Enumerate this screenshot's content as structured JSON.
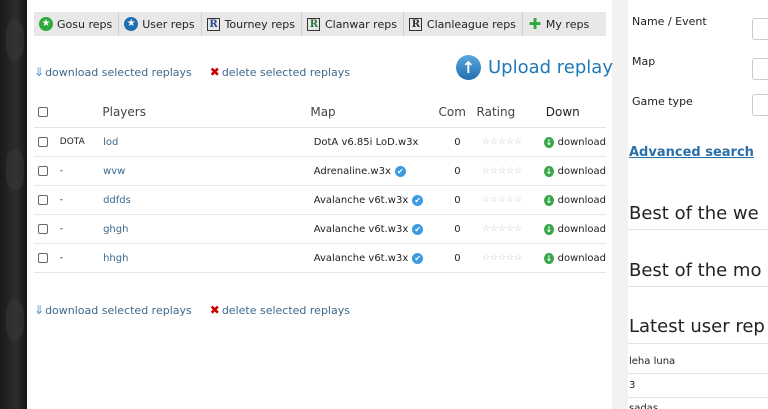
{
  "tabs": [
    {
      "label": "Gosu reps",
      "icon": "green-star-circle-icon"
    },
    {
      "label": "User reps",
      "icon": "blue-star-circle-icon"
    },
    {
      "label": "Tourney reps",
      "icon": "r-box-icon"
    },
    {
      "label": "Clanwar reps",
      "icon": "r-box-green-icon"
    },
    {
      "label": "Clanleague reps",
      "icon": "r-box-icon"
    },
    {
      "label": "My reps",
      "icon": "green-plus-icon"
    }
  ],
  "actions": {
    "download_selected": "download selected replays",
    "delete_selected": "delete selected replays"
  },
  "upload_label": "Upload replay",
  "table": {
    "headers": {
      "players": "Players",
      "map": "Map",
      "com": "Com",
      "rating": "Rating",
      "down": "Down"
    },
    "rows": [
      {
        "game": "DOTA",
        "player": "lod",
        "map": "DotA v6.85i LoD.w3x",
        "verified": false,
        "com": "0",
        "download": "download"
      },
      {
        "game": "-",
        "player": "wvw",
        "map": "Adrenaline.w3x",
        "verified": true,
        "com": "0",
        "download": "download"
      },
      {
        "game": "-",
        "player": "ddfds",
        "map": "Avalanche v6t.w3x",
        "verified": true,
        "com": "0",
        "download": "download"
      },
      {
        "game": "-",
        "player": "ghgh",
        "map": "Avalanche v6t.w3x",
        "verified": true,
        "com": "0",
        "download": "download"
      },
      {
        "game": "-",
        "player": "hhgh",
        "map": "Avalanche v6t.w3x",
        "verified": true,
        "com": "0",
        "download": "download"
      }
    ]
  },
  "sidebar": {
    "fields": [
      {
        "label": "Name / Event"
      },
      {
        "label": "Map"
      },
      {
        "label": "Game type"
      }
    ],
    "advanced_search": "Advanced search",
    "best_week": "Best of the we",
    "best_month": "Best of the mo",
    "latest_user": "Latest user rep",
    "latest_items": [
      "leha luna",
      "3",
      "sadas"
    ]
  },
  "colors": {
    "link": "#3c6a8e",
    "accent": "#1f78b8",
    "tab_bg": "#e8e8e8",
    "download_green": "#3aa84a",
    "verified_blue": "#3b9be0"
  }
}
